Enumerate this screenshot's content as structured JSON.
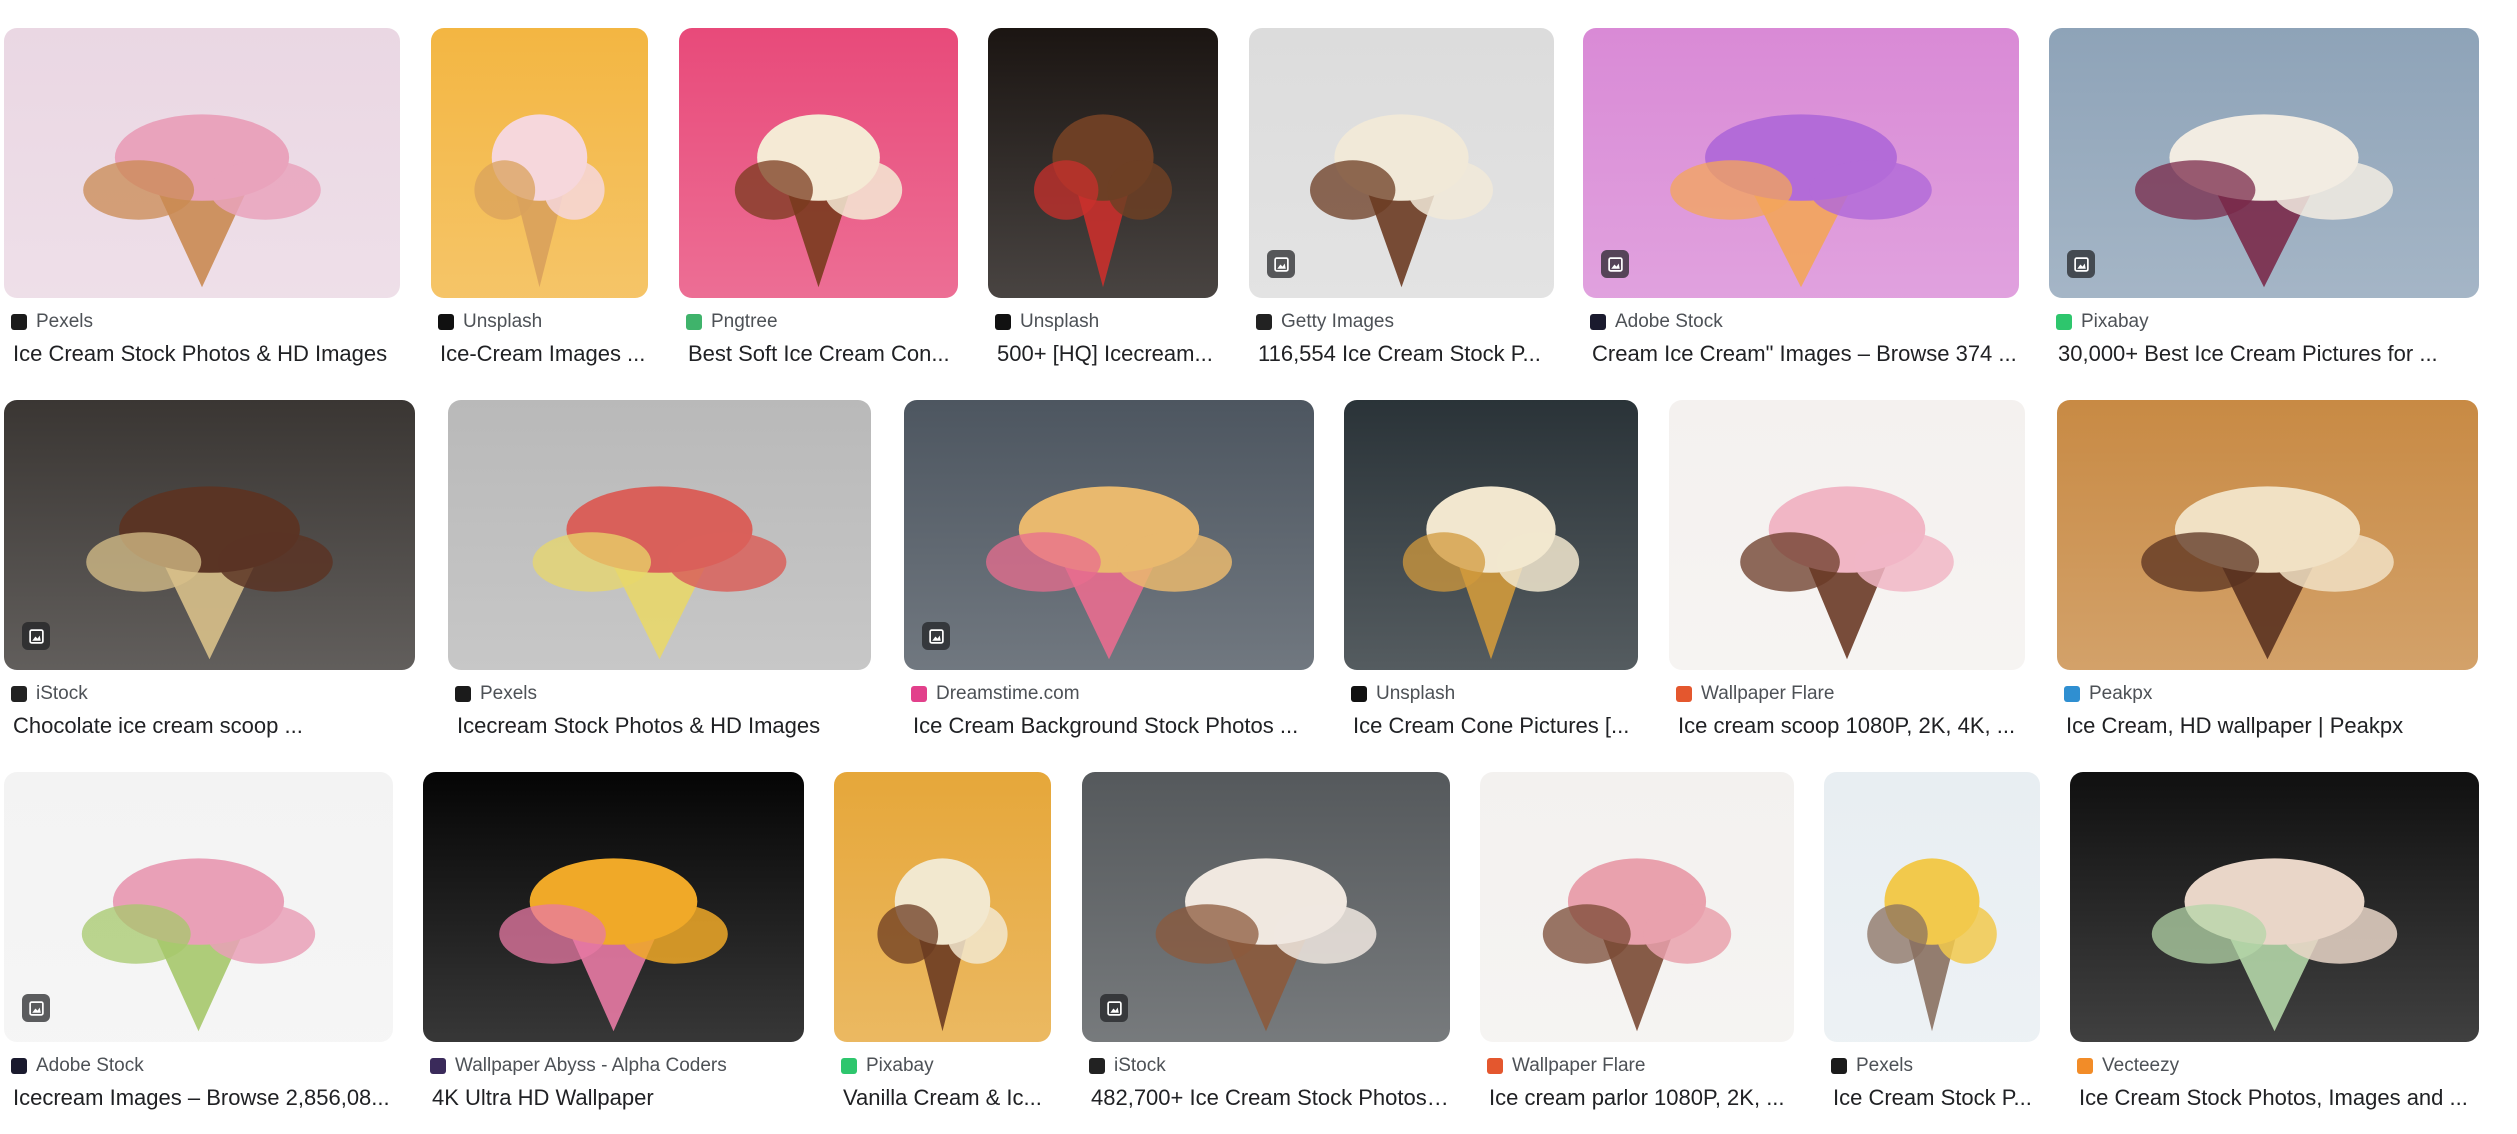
{
  "results": [
    {
      "source": "Pexels",
      "title": "Ice Cream Stock Photos & HD Images",
      "favicon": "pexels-icon",
      "fav_color": "#1b1b1b",
      "bg": "#ead7e3",
      "accent": "#e9a3bc",
      "accent2": "#c98a52",
      "badge": false
    },
    {
      "source": "Unsplash",
      "title": "Ice-Cream Images ...",
      "favicon": "unsplash-icon",
      "fav_color": "#111111",
      "bg": "#f3b642",
      "accent": "#f6d7dc",
      "accent2": "#d9a15c",
      "badge": false
    },
    {
      "source": "Pngtree",
      "title": "Best Soft Ice Cream Con...",
      "favicon": "pngtree-icon",
      "fav_color": "#3fb36b",
      "bg": "#e84a7a",
      "accent": "#f5ead5",
      "accent2": "#7a3b1e",
      "badge": false
    },
    {
      "source": "Unsplash",
      "title": "500+ [HQ] Icecream...",
      "favicon": "unsplash-icon",
      "fav_color": "#111111",
      "bg": "#1b1512",
      "accent": "#6d3f25",
      "accent2": "#c9302c",
      "badge": false
    },
    {
      "source": "Getty Images",
      "title": "116,554 Ice Cream Stock P...",
      "favicon": "getty-icon",
      "fav_color": "#222222",
      "bg": "#dcdcdc",
      "accent": "#f1e9d8",
      "accent2": "#6b3b22",
      "badge": true
    },
    {
      "source": "Adobe Stock",
      "title": "Cream Ice Cream\" Images – Browse 374 ...",
      "favicon": "adobe-stock-icon",
      "fav_color": "#1a1a2e",
      "bg": "#d98ad6",
      "accent": "#b36bd8",
      "accent2": "#f3a55a",
      "badge": true
    },
    {
      "source": "Pixabay",
      "title": "30,000+ Best Ice Cream Pictures for ...",
      "favicon": "pixabay-icon",
      "fav_color": "#2ec66d",
      "bg": "#8ea3b8",
      "accent": "#f2ece2",
      "accent2": "#7a2a4a",
      "badge": true
    },
    {
      "source": "iStock",
      "title": "Chocolate ice cream scoop ...",
      "favicon": "istock-icon",
      "fav_color": "#222222",
      "bg": "#3a3633",
      "accent": "#5a3424",
      "accent2": "#d8c08a",
      "badge": true
    },
    {
      "source": "Pexels",
      "title": "Icecream Stock Photos & HD Images",
      "favicon": "pexels-icon",
      "fav_color": "#1b1b1b",
      "bg": "#b9b9b9",
      "accent": "#d9605a",
      "accent2": "#e8d76a",
      "badge": false
    },
    {
      "source": "Dreamstime.com",
      "title": "Ice Cream Background Stock Photos ...",
      "favicon": "dreamstime-icon",
      "fav_color": "#e2408b",
      "bg": "#4d5660",
      "accent": "#e9b96e",
      "accent2": "#e86d8f",
      "badge": true
    },
    {
      "source": "Unsplash",
      "title": "Ice Cream Cone Pictures [...",
      "favicon": "unsplash-icon",
      "fav_color": "#111111",
      "bg": "#2a3338",
      "accent": "#f2e7cf",
      "accent2": "#d19a3c",
      "badge": false
    },
    {
      "source": "Wallpaper Flare",
      "title": "Ice cream scoop 1080P, 2K, 4K, ...",
      "favicon": "wallpaper-flare-icon",
      "fav_color": "#e4572e",
      "bg": "#f4f1ef",
      "accent": "#f1b6c5",
      "accent2": "#6a3a26",
      "badge": false
    },
    {
      "source": "Peakpx",
      "title": "Ice Cream, HD wallpaper | Peakpx",
      "favicon": "peakpx-icon",
      "fav_color": "#2f8fd1",
      "bg": "#c88a44",
      "accent": "#f1e1c4",
      "accent2": "#5a3220",
      "badge": false
    },
    {
      "source": "Adobe Stock",
      "title": "Icecream Images – Browse 2,856,08...",
      "favicon": "adobe-stock-icon",
      "fav_color": "#1a1a2e",
      "bg": "#f3f3f3",
      "accent": "#e9a0b7",
      "accent2": "#a6c86b",
      "badge": true
    },
    {
      "source": "Wallpaper Abyss - Alpha Coders",
      "title": "4K Ultra HD Wallpaper",
      "favicon": "wallpaper-abyss-icon",
      "fav_color": "#3a2a5a",
      "bg": "#050505",
      "accent": "#f0a928",
      "accent2": "#e87aa4",
      "badge": false
    },
    {
      "source": "Pixabay",
      "title": "Vanilla Cream & Ic...",
      "favicon": "pixabay-icon",
      "fav_color": "#2ec66d",
      "bg": "#e6a73a",
      "accent": "#f2e8cf",
      "accent2": "#6b3b22",
      "badge": false
    },
    {
      "source": "iStock",
      "title": "482,700+ Ice Cream Stock Photos ...",
      "favicon": "istock-icon",
      "fav_color": "#222222",
      "bg": "#55595c",
      "accent": "#f0e8e0",
      "accent2": "#8c5a3c",
      "badge": true
    },
    {
      "source": "Wallpaper Flare",
      "title": "Ice cream parlor 1080P, 2K, ...",
      "favicon": "wallpaper-flare-icon",
      "fav_color": "#e4572e",
      "bg": "#f3f1ef",
      "accent": "#e9a1ad",
      "accent2": "#7a4a34",
      "badge": false
    },
    {
      "source": "Pexels",
      "title": "Ice Cream Stock P...",
      "favicon": "pexels-icon",
      "fav_color": "#1b1b1b",
      "bg": "#e8eef2",
      "accent": "#f2c94c",
      "accent2": "#8a7060",
      "badge": false
    },
    {
      "source": "Vecteezy",
      "title": "Ice Cream Stock Photos, Images and ...",
      "favicon": "vecteezy-icon",
      "fav_color": "#f28c28",
      "bg": "#101010",
      "accent": "#e9d6c8",
      "accent2": "#b4d6a8",
      "badge": false
    }
  ]
}
